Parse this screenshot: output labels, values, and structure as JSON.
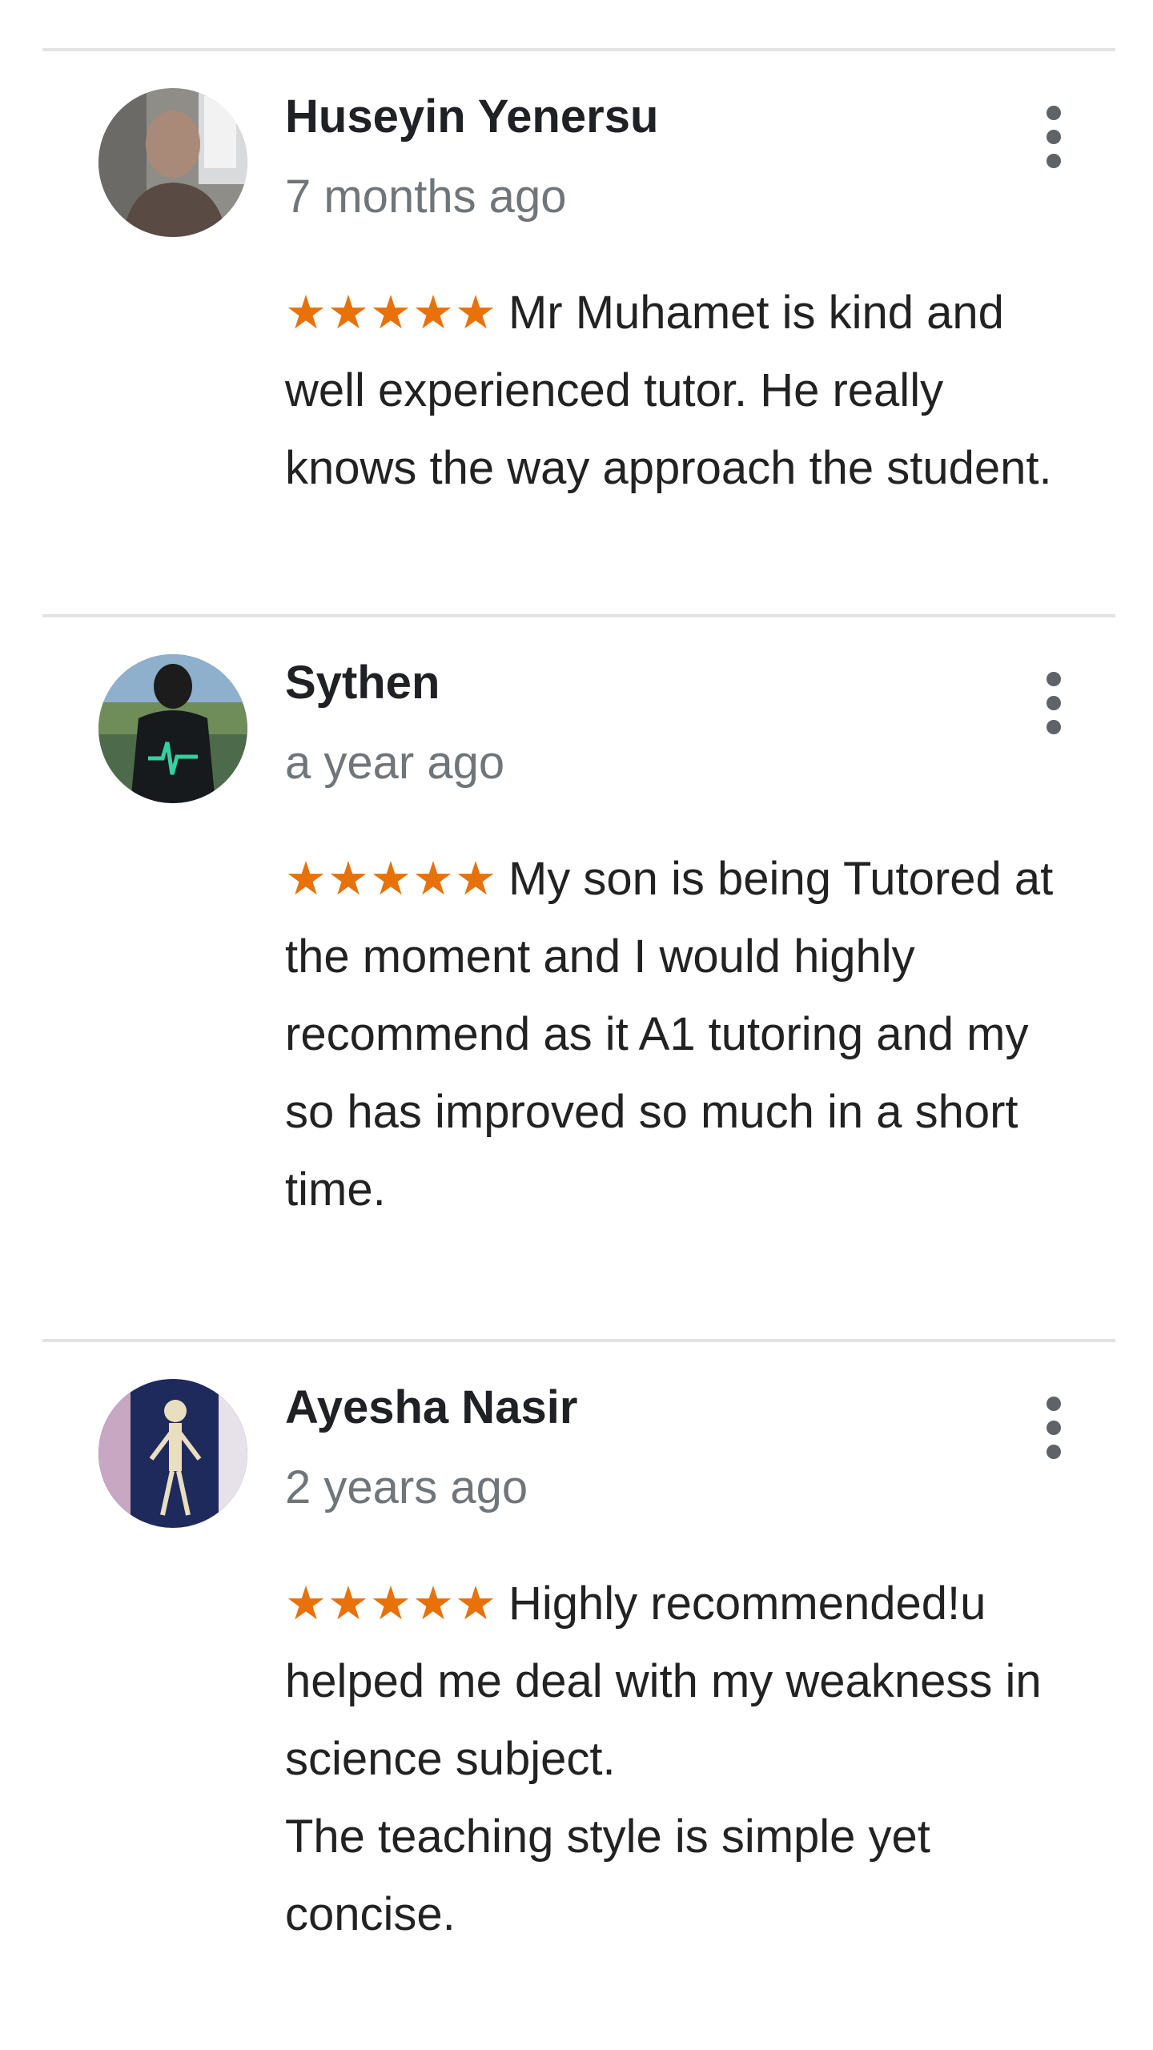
{
  "reviews": [
    {
      "name": "Huseyin Yenersu",
      "time": "7 months ago",
      "stars": "★★★★★",
      "rating": 5,
      "text": "Mr Muhamet is kind and well experienced tutor. He really knows the way approach the student."
    },
    {
      "name": "Sythen",
      "time": "a year ago",
      "stars": "★★★★★",
      "rating": 5,
      "text": "My son is being Tutored at the moment and I would highly recommend as it A1 tutoring and my so has improved so much in a short time."
    },
    {
      "name": "Ayesha Nasir",
      "time": "2 years ago",
      "stars": "★★★★★",
      "rating": 5,
      "text": "Highly recommended!u helped me deal with my weakness in science subject.\nThe teaching style is simple yet concise."
    }
  ],
  "colors": {
    "star": "#e8710a",
    "name": "#202124",
    "time": "#70757a",
    "divider": "#e3e3e3"
  },
  "icons": {
    "more": "more-vert-icon",
    "star": "star-icon"
  }
}
